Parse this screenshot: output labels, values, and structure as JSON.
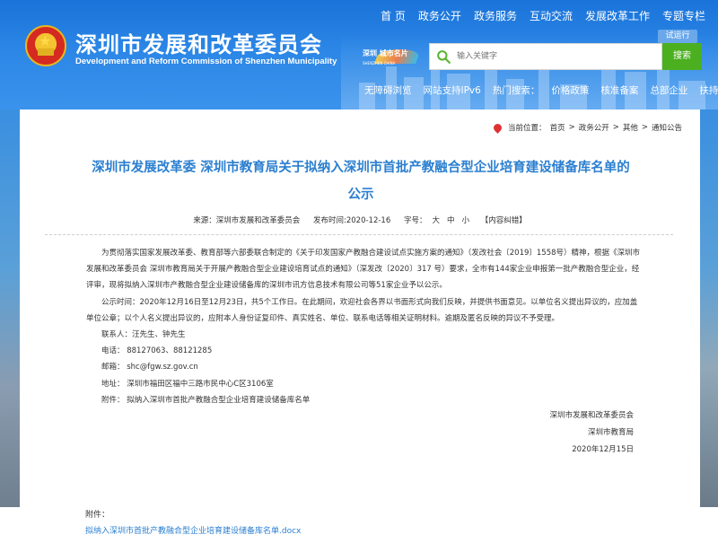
{
  "site": {
    "title_cn": "深圳市发展和改革委员会",
    "title_en": "Development and Reform Commission of Shenzhen Municipality",
    "trial_badge": "试运行",
    "logo_text": "深圳 城市名片",
    "logo_sub": "SHENZHEN CHINA"
  },
  "nav": {
    "items": [
      "首 页",
      "政务公开",
      "政务服务",
      "互动交流",
      "发展改革工作",
      "专题专栏"
    ]
  },
  "search": {
    "placeholder": "输入关键字",
    "button": "搜索"
  },
  "subnav": {
    "accessible": "无障碍浏览",
    "ipv6": "网站支持IPv6",
    "hot_label": "热门搜索：",
    "hot": [
      "价格政策",
      "核准备案",
      "总部企业",
      "扶持计划"
    ]
  },
  "breadcrumb": {
    "label": "当前位置：",
    "items": [
      "首页",
      "政务公开",
      "其他",
      "通知公告"
    ],
    "sep": ">"
  },
  "article": {
    "title_line1": "深圳市发展改革委 深圳市教育局关于拟纳入深圳市首批产教融合型企业培育建设储备库名单的",
    "title_line2": "公示",
    "source_label": "来源：深圳市发展和改革委员会",
    "date_label": "发布时间:2020-12-16",
    "font_label": "字号：",
    "font_sizes": [
      "大",
      "中",
      "小"
    ],
    "correction": "【内容纠错】",
    "para1": "为贯彻落实国家发展改革委、教育部等六部委联合制定的《关于印发国家产教融合建设试点实施方案的通知》（发改社会〔2019〕1558号）精神，根据《深圳市发展和改革委员会 深圳市教育局关于开展产教融合型企业建设培育试点的通知》（深发改〔2020〕317 号）要求，全市有144家企业申报第一批产教融合型企业，经评审，现将拟纳入深圳市产教融合型企业建设储备库的深圳市讯方信息技术有限公司等51家企业予以公示。",
    "para2": "公示时间：2020年12月16日至12月23日，共5个工作日。在此期间，欢迎社会各界以书面形式向我们反映，并提供书面意见。以单位名义提出异议的，应加盖单位公章；以个人名义提出异议的，应附本人身份证复印件、真实姓名、单位、联系电话等相关证明材料。逾期及匿名反映的异议不予受理。",
    "contact": "联系人：汪先生、钟先生",
    "phone": "电话：  88127063、88121285",
    "email": "邮箱：  shc@fgw.sz.gov.cn",
    "address": "地址：  深圳市福田区福中三路市民中心C区3106室",
    "attachment_line": "附件：  拟纳入深圳市首批产教融合型企业培育建设储备库名单",
    "sign1": "深圳市发展和改革委员会",
    "sign2": "深圳市教育局",
    "sign_date": "2020年12月15日"
  },
  "attachment": {
    "label": "附件：",
    "file": "拟纳入深圳市首批产教融合型企业培育建设储备库名单.docx"
  },
  "colors": {
    "header_blue": "#2b86e6",
    "title_blue": "#2b7fd0",
    "search_green": "#4caf20"
  }
}
